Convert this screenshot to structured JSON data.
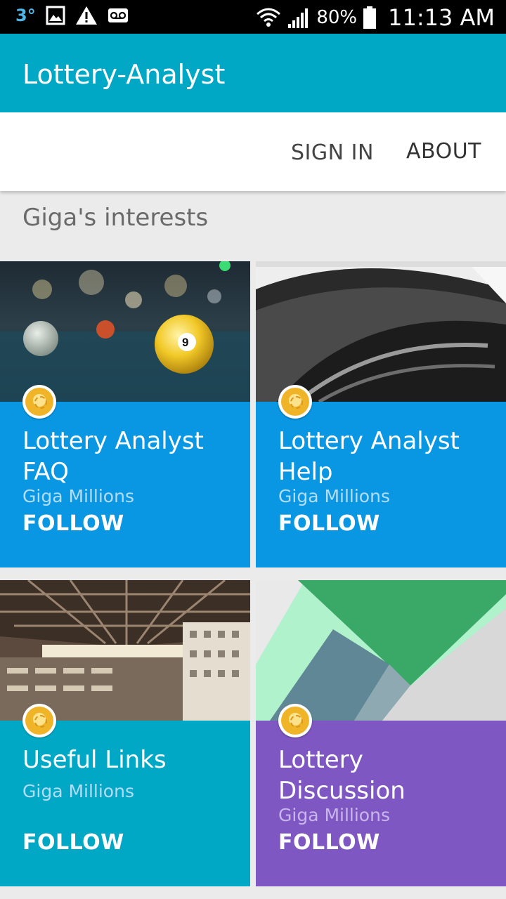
{
  "status_bar": {
    "temp": "3°",
    "battery": "80%",
    "time": "11:13 AM"
  },
  "app_bar": {
    "title": "Lottery-Analyst"
  },
  "actions": {
    "sign_in": "SIGN IN",
    "about": "ABOUT"
  },
  "section": {
    "title": "Giga's interests"
  },
  "cards": [
    {
      "title": "Lottery Analyst FAQ",
      "subtitle": "Giga Millions",
      "follow": "FOLLOW",
      "color": "#0996e2"
    },
    {
      "title": "Lottery Analyst Help",
      "subtitle": "Giga Millions",
      "follow": "FOLLOW",
      "color": "#0996e2"
    },
    {
      "title": "Useful Links",
      "subtitle": "Giga Millions",
      "follow": "FOLLOW",
      "color": "#00a8c6"
    },
    {
      "title": "Lottery Discussion",
      "subtitle": "Giga Millions",
      "follow": "FOLLOW",
      "color": "#7e57c2"
    }
  ],
  "icons": {
    "status_left": [
      "photo-icon",
      "warning-icon",
      "voicemail-icon"
    ],
    "status_right": [
      "wifi-icon",
      "signal-icon",
      "battery-icon"
    ]
  }
}
